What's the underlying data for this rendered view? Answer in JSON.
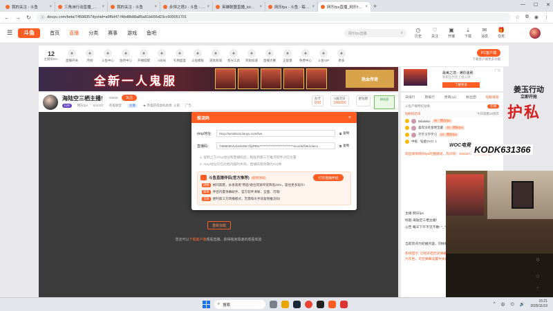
{
  "browser": {
    "tabs": [
      {
        "label": "我的关注 - 斗鱼",
        "active": false
      },
      {
        "label": "三角洲行动直播_三角洲行动直...",
        "active": false
      },
      {
        "label": "我的关注 - 斗鱼",
        "active": false
      },
      {
        "label": "永恒之塔2 - 斗鱼 - 每个人的直...",
        "active": false
      },
      {
        "label": "英雄联盟直播_lol直播_英雄联...",
        "active": false
      },
      {
        "label": "网乐fps - 斗鱼 - 每个人的直...",
        "active": false
      },
      {
        "label": "网乐fps直播_网乐fps直播间_...",
        "active": true
      }
    ],
    "new_tab": "+",
    "url": "douyu.com/beta/74598357dyshid=a9f5d47-f4bd8b88a85a81b656d23cc900051701"
  },
  "site": {
    "logo": "斗鱼",
    "nav": [
      "首页",
      "直播",
      "分类",
      "赛事",
      "游戏",
      "鱼吧"
    ],
    "search_placeholder": "网乐fps直播",
    "header_icons": [
      {
        "icon": "history-icon",
        "label": "历史"
      },
      {
        "icon": "follow-icon",
        "label": "关注"
      },
      {
        "icon": "live-icon",
        "label": "开播"
      },
      {
        "icon": "download-icon",
        "label": "下载"
      },
      {
        "icon": "message-icon",
        "label": "消息"
      },
      {
        "icon": "gift-icon",
        "label": "任务"
      }
    ]
  },
  "categories": {
    "follow_count": "12",
    "follow_label": "主播榜99+",
    "items": [
      "直播开关",
      "月榜",
      "斗鱼中心",
      "鱼吧中心",
      "开播提醒",
      "A局局",
      "礼物盛宴",
      "斗鱼模板",
      "道具商城",
      "星光工具",
      "奖励加速",
      "直播大赛",
      "正能量",
      "免费中心",
      "斗鱼VIP",
      "更多"
    ],
    "pc_btn": "PC客户端",
    "pc_sub": "下载客户端更多功能"
  },
  "banner": {
    "title": "全新一人鬼服",
    "right_text": "热血传奇"
  },
  "ad": {
    "title": "最美之境 - 满阶速刷",
    "sub": "新职业时装上线公测",
    "button": "了解更多",
    "tag": "广告"
  },
  "room": {
    "title": "海陆空三栖主播!",
    "id": "30826",
    "follow": "关注",
    "level": "LV8",
    "owner": "网乐fps",
    "room_num": "634327",
    "category": "英雄联盟",
    "tag": "主播",
    "notice": "★ 恭喜获得虚拟勋章: 火箭",
    "report": "广告",
    "stats": [
      {
        "label": "办卡",
        "value": "0/10"
      },
      {
        "label": "1展次日",
        "value": "100/200"
      },
      {
        "label": "金钻赠",
        "value": ""
      }
    ],
    "fans_label": "粉丝团"
  },
  "player": {
    "play_button": "重新加载",
    "note_pre": "您还可以",
    "note_link": "下载客户端",
    "note_post": "观看直播，获得独家极速的观看体验"
  },
  "modal": {
    "title": "推流码",
    "close": "×",
    "rtmp_label": "rtmp地址:",
    "rtmp_value": "rtmp://sendtvo3.douyu.com/live",
    "code_label": "直播码:",
    "code_value": "7459835r4vSnzkWin?dyPRtx****************************ecordx/fv8ronieco",
    "copy": "复制",
    "tips": [
      "1. 复制上方rtmp地址和直播码后，粘贴到第三方推流软件对应位置",
      "2. rtmp地址仅在此框内临时失效，直播码有效期为5分钟"
    ],
    "promo_title": "斗鱼直播伴侣(官方推荐)",
    "promo_badge": "(使用须知)",
    "promo_button": "打开直播伴侣",
    "promo_lines": [
      {
        "tag": "流畅",
        "text": "帧同黑匮，永发观看\"原画\"助位同速带宽降低20%，容住更多观众!"
      },
      {
        "tag": "简单",
        "text": "伴侣内置弹幕助手、官方软件清晰、全面、可靠!"
      },
      {
        "tag": "全屏",
        "text": "便利第三方转播模式，无需每天手动复制推流码!"
      }
    ]
  },
  "chat": {
    "tabs": [
      "日排行",
      "周排行",
      "贵宾(11)",
      "粉丝团",
      "钻粉排名"
    ],
    "sub_left": "斗鱼产播特权勋章",
    "sub_pill": "在线",
    "list_title": "钻粉纪念日",
    "list_right": "今日观看10周年",
    "rows": [
      {
        "name": "Bibalabo",
        "tag": "25 · 网乐fps"
      },
      {
        "name": "喜欢没有金明宝藏",
        "tag": "25 · 网乐fps"
      },
      {
        "name": "学学习学学习",
        "tag": "24 · 网乐fps"
      },
      {
        "name": "中级 · 钻金OVO: 1",
        "tag": ""
      }
    ],
    "messages": [
      "欢迎来到网乐fps的直播间，房间号：634327，快来观看吧！",
      "主播 网乐fps",
      "标题 海陆空三栖主播！",
      "公告 每天下午不见不散! ^_^ 合作: qq 962380520注明来意!",
      "当前房间为轮播内容，同样精彩哦~",
      "系统提示: 已经开启历史弹幕(历史弹幕只在播放器上展示，默认为灰色，可在弹幕设置中关闭)"
    ]
  },
  "overlay": {
    "event_title": "姜玉行动",
    "event_sub": "立即开抢",
    "red_text": "护私",
    "code_text": "KODK631366",
    "brand": "WOC电竞"
  },
  "taskbar": {
    "search": "搜索",
    "lang": "中",
    "time": "15:21",
    "date": "2025/11/19"
  }
}
